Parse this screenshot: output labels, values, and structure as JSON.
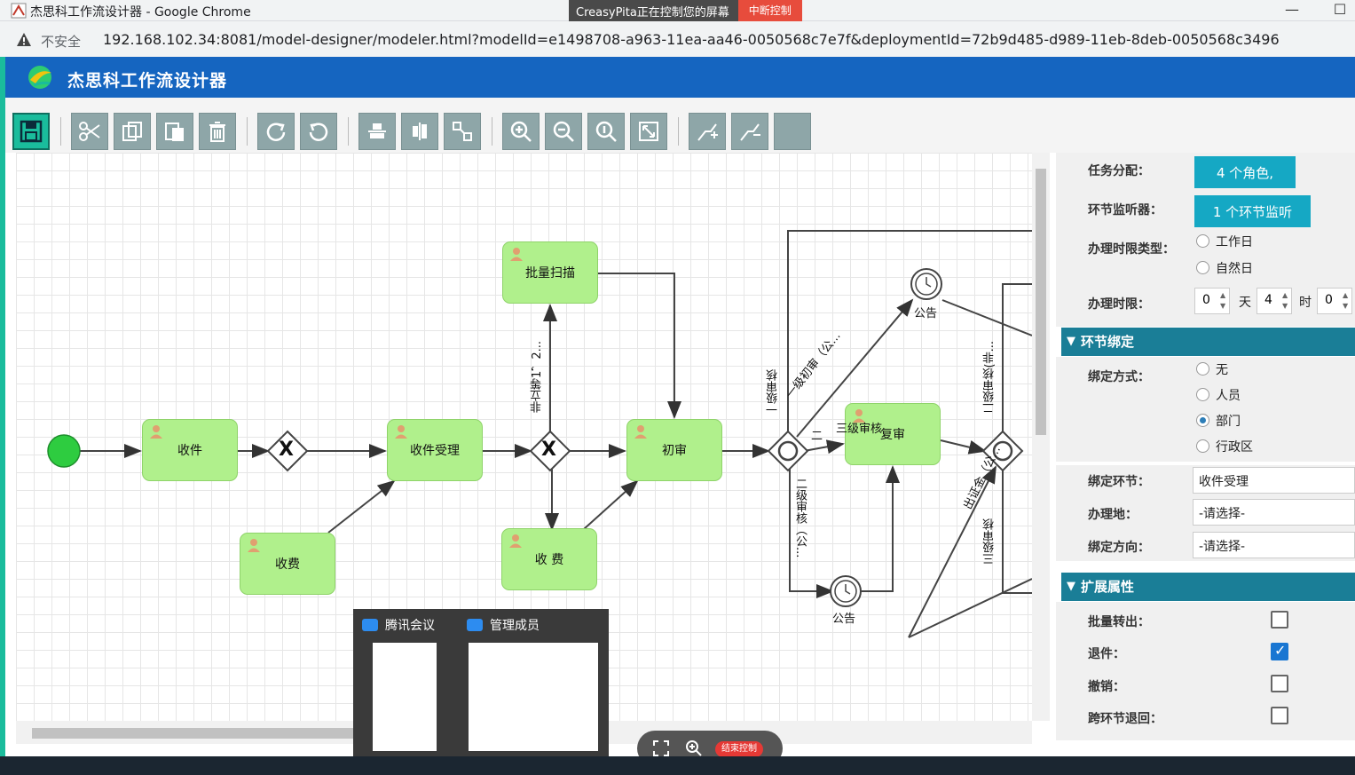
{
  "browser": {
    "window_title": "杰思科工作流设计器 - Google Chrome",
    "share_banner_text": "CreasyPita正在控制您的屏幕",
    "share_stop_label": "中断控制",
    "minimize_glyph": "—",
    "maximize_glyph": "☐",
    "insecure_label": "不安全",
    "url": "192.168.102.34:8081/model-designer/modeler.html?modelId=e1498708-a963-11ea-aa46-0050568c7e7f&deploymentId=72b9d485-d989-11eb-8deb-0050568c3496"
  },
  "app": {
    "title": "杰思科工作流设计器"
  },
  "toolbar": {
    "buttons": [
      "save-icon",
      "cut-icon",
      "copy-icon",
      "paste-icon",
      "delete-icon",
      "redo-icon",
      "undo-icon",
      "align-horizontal-icon",
      "align-vertical-icon",
      "same-size-icon",
      "zoom-in-icon",
      "zoom-out-icon",
      "zoom-actual-icon",
      "zoom-fit-icon",
      "add-bendpoint-icon",
      "remove-bendpoint-icon",
      "blank-button"
    ]
  },
  "diagram": {
    "tasks": {
      "shoujian": "收件",
      "shoufei1": "收费",
      "shoujian_shouli": "收件受理",
      "piliang": "批量扫描",
      "shoufei2": "收 费",
      "chushen": "初审",
      "fushen": "复审"
    },
    "gateway_x": "X",
    "labels": {
      "gonggao1": "公告",
      "gonggao2": "公告",
      "third_level_check": "三级审核",
      "first_level_initial": "一级初审（公...",
      "second_level": "二",
      "first_level": "一级审核",
      "not_equal": "非立等1，2...",
      "second_level_audit": "二级审核（公...",
      "second_level_right": "二级审核(非...",
      "three_level_right": "三级审核",
      "chu_zheng_jin": "出证金（公..."
    }
  },
  "panel": {
    "task_assign_label": "任务分配：",
    "task_assign_value": "4 个角色,",
    "listener_label": "环节监听器：",
    "listener_value": "1 个环节监听",
    "deadline_type_label": "办理时限类型：",
    "deadline_type_options": [
      "工作日",
      "自然日"
    ],
    "deadline_label": "办理时限：",
    "deadline_days": "0",
    "deadline_days_unit": "天",
    "deadline_hours": "4",
    "deadline_hours_unit": "时",
    "deadline_minutes": "0",
    "binding_section": "环节绑定",
    "binding_mode_label": "绑定方式：",
    "binding_modes": [
      "无",
      "人员",
      "部门",
      "行政区"
    ],
    "binding_selected": "部门",
    "binding_node_label": "绑定环节：",
    "binding_node_value": "收件受理",
    "office_label": "办理地：",
    "office_value": "-请选择-",
    "direction_label": "绑定方向：",
    "direction_value": "-请选择-",
    "extension_section": "扩展属性",
    "batch_out_label": "批量转出：",
    "batch_out_checked": false,
    "return_label": "退件：",
    "return_checked": true,
    "cancel_label": "撤销：",
    "cancel_checked": false,
    "cross_return_label": "跨环节退回：",
    "cross_return_checked": false
  },
  "meeting": {
    "app1": "腾讯会议",
    "app2": "管理成员",
    "end_control": "结束控制"
  }
}
